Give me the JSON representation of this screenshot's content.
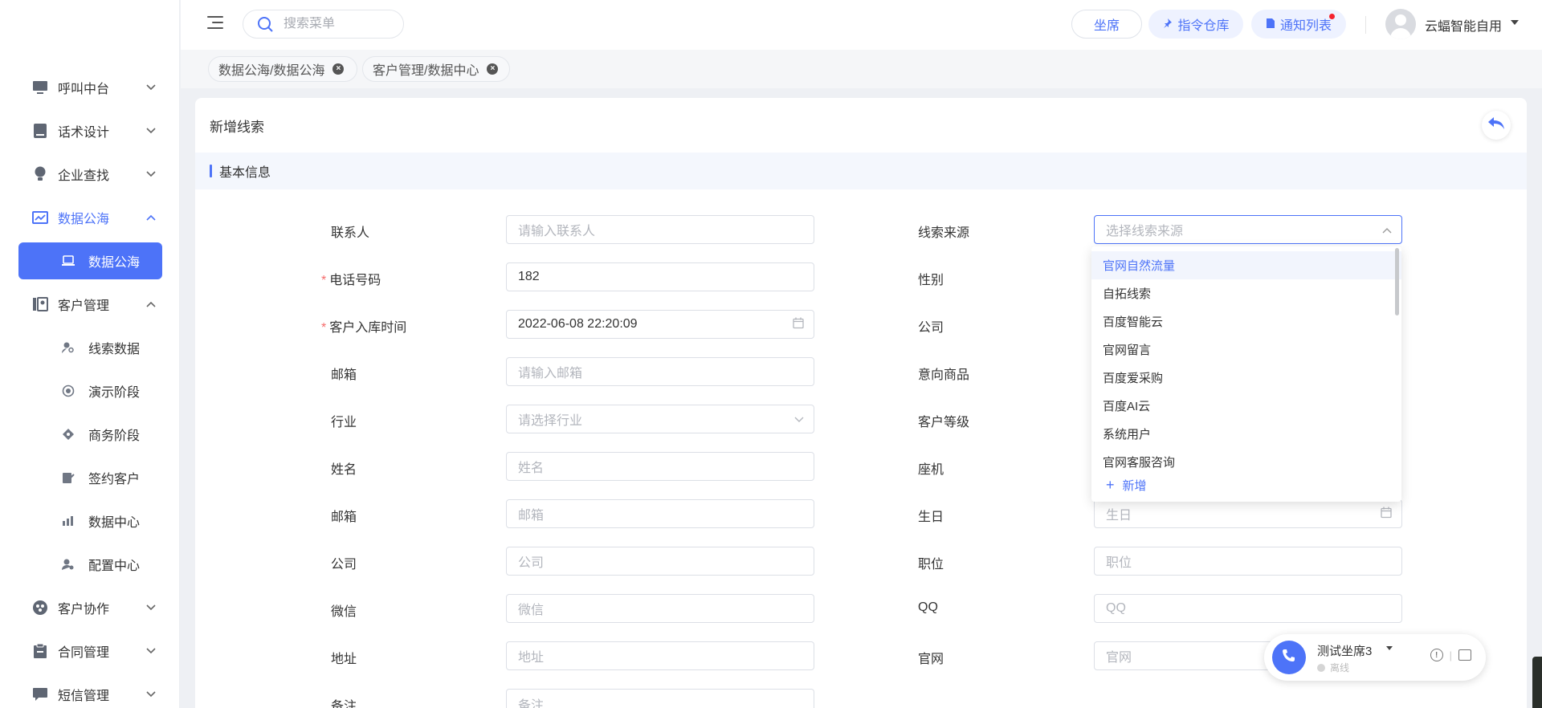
{
  "header": {
    "search_placeholder": "搜索菜单",
    "buttons": {
      "seat": "坐席",
      "command": "指令仓库",
      "notify": "通知列表"
    },
    "username": "云蝠智能自用"
  },
  "sidebar": {
    "items": [
      {
        "label": "呼叫中台"
      },
      {
        "label": "话术设计"
      },
      {
        "label": "企业查找"
      },
      {
        "label": "数据公海"
      },
      {
        "label": "数据公海"
      },
      {
        "label": "客户管理"
      },
      {
        "label": "线索数据"
      },
      {
        "label": "演示阶段"
      },
      {
        "label": "商务阶段"
      },
      {
        "label": "签约客户"
      },
      {
        "label": "数据中心"
      },
      {
        "label": "配置中心"
      },
      {
        "label": "客户协作"
      },
      {
        "label": "合同管理"
      },
      {
        "label": "短信管理"
      }
    ]
  },
  "tags": [
    {
      "label": "数据公海/数据公海"
    },
    {
      "label": "客户管理/数据中心"
    }
  ],
  "form": {
    "title": "新增线索",
    "section": "基本信息",
    "left": [
      {
        "label": "联系人",
        "required": false,
        "placeholder": "请输入联系人",
        "value": ""
      },
      {
        "label": "电话号码",
        "required": true,
        "placeholder": "",
        "value": "182"
      },
      {
        "label": "客户入库时间",
        "required": true,
        "placeholder": "",
        "value": "2022-06-08 22:20:09"
      },
      {
        "label": "邮箱",
        "required": false,
        "placeholder": "请输入邮箱",
        "value": ""
      },
      {
        "label": "行业",
        "required": false,
        "placeholder": "请选择行业",
        "value": ""
      },
      {
        "label": "姓名",
        "required": false,
        "placeholder": "姓名",
        "value": ""
      },
      {
        "label": "邮箱",
        "required": false,
        "placeholder": "邮箱",
        "value": ""
      },
      {
        "label": "公司",
        "required": false,
        "placeholder": "公司",
        "value": ""
      },
      {
        "label": "微信",
        "required": false,
        "placeholder": "微信",
        "value": ""
      },
      {
        "label": "地址",
        "required": false,
        "placeholder": "地址",
        "value": ""
      },
      {
        "label": "备注",
        "required": false,
        "placeholder": "备注",
        "value": ""
      }
    ],
    "right": [
      {
        "label": "线索来源",
        "placeholder": "选择线索来源"
      },
      {
        "label": "性别",
        "placeholder": ""
      },
      {
        "label": "公司",
        "placeholder": ""
      },
      {
        "label": "意向商品",
        "placeholder": ""
      },
      {
        "label": "客户等级",
        "placeholder": ""
      },
      {
        "label": "座机",
        "placeholder": ""
      },
      {
        "label": "生日",
        "placeholder": "生日"
      },
      {
        "label": "职位",
        "placeholder": "职位"
      },
      {
        "label": "QQ",
        "placeholder": "QQ"
      },
      {
        "label": "官网",
        "placeholder": "官网"
      }
    ]
  },
  "dropdown": {
    "options": [
      "官网自然流量",
      "自拓线索",
      "百度智能云",
      "官网留言",
      "百度爱采购",
      "百度AI云",
      "系统用户",
      "官网客服咨询"
    ],
    "add_label": "新增"
  },
  "softphone": {
    "name": "测试坐席3",
    "status": "离线"
  },
  "colors": {
    "accent": "#4d73f8",
    "required": "#f56c6c",
    "notify_dot": "#f5222d"
  }
}
